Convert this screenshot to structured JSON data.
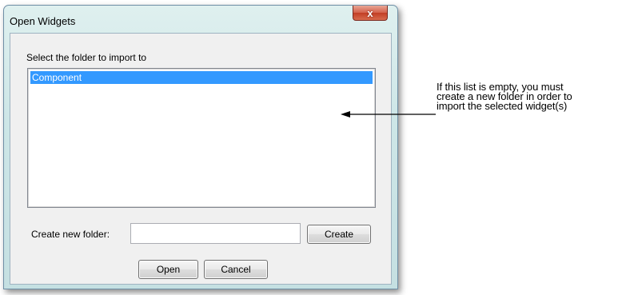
{
  "window": {
    "title": "Open Widgets",
    "close_glyph": "x"
  },
  "folder_list": {
    "label": "Select the folder to import to",
    "items": [
      {
        "label": "Component",
        "selected": true
      }
    ]
  },
  "new_folder": {
    "label": "Create new folder:",
    "value": "",
    "create_label": "Create"
  },
  "footer": {
    "open_label": "Open",
    "cancel_label": "Cancel"
  },
  "annotation": {
    "lines": [
      "If this list is empty, you must",
      "create a new folder in order to",
      "import the selected widget(s)"
    ]
  },
  "colors": {
    "selection": "#3399ff",
    "close_button": "#c23e24",
    "frame": "#cde6e7"
  }
}
